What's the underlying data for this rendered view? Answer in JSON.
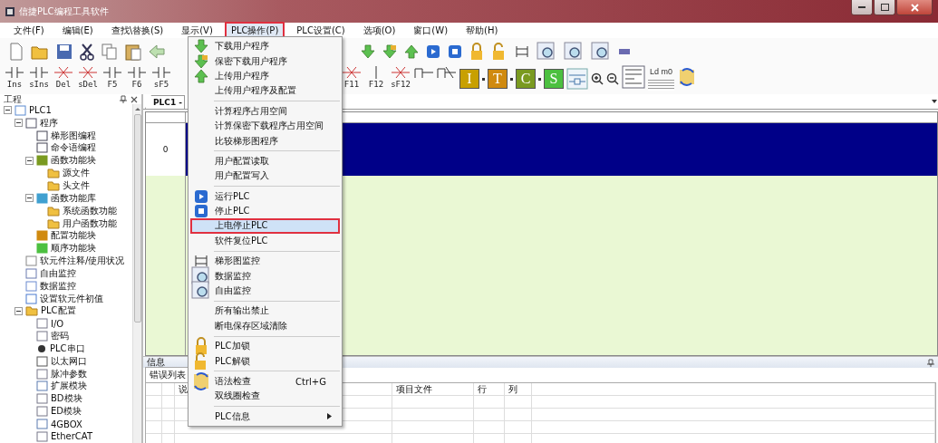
{
  "window": {
    "title": "信捷PLC编程工具软件"
  },
  "menu_bar": [
    {
      "label": "文件(F)",
      "open": false,
      "annotated": false
    },
    {
      "label": "编辑(E)",
      "open": false,
      "annotated": false
    },
    {
      "label": "查找\\替换(S)",
      "open": false,
      "annotated": false
    },
    {
      "label": "显示(V)",
      "open": false,
      "annotated": false
    },
    {
      "label": "PLC操作(P)",
      "open": true,
      "annotated": true
    },
    {
      "label": "PLC设置(C)",
      "open": false,
      "annotated": false
    },
    {
      "label": "选项(O)",
      "open": false,
      "annotated": false
    },
    {
      "label": "窗口(W)",
      "open": false,
      "annotated": false
    },
    {
      "label": "帮助(H)",
      "open": false,
      "annotated": false
    }
  ],
  "toolbar_keys_left": [
    "Ins",
    "sIns",
    "Del",
    "sDel",
    "F5",
    "F6",
    "sF5"
  ],
  "toolbar_keys_right": [
    "F11",
    "F12",
    "sF12"
  ],
  "toolbar_letters": [
    {
      "label": "I",
      "color": "#c8a000"
    },
    {
      "label": "T",
      "color": "#d08a10"
    },
    {
      "label": "C",
      "color": "#7a9a20"
    },
    {
      "label": "S",
      "color": "#4cc040"
    }
  ],
  "toolbar_ld_label": "Ld m0",
  "project_panel": {
    "title": "工程",
    "tree": [
      {
        "label": "PLC1",
        "kind": "project",
        "expanded": true,
        "children": [
          {
            "label": "程序",
            "kind": "program",
            "expanded": true,
            "children": [
              {
                "label": "梯形图编程",
                "kind": "ladder"
              },
              {
                "label": "命令语编程",
                "kind": "command"
              },
              {
                "label": "函数功能块",
                "kind": "block-c",
                "expanded": true,
                "children": [
                  {
                    "label": "源文件",
                    "kind": "folder"
                  },
                  {
                    "label": "头文件",
                    "kind": "folder"
                  }
                ]
              },
              {
                "label": "函数功能库",
                "kind": "block-ex",
                "expanded": true,
                "children": [
                  {
                    "label": "系统函数功能",
                    "kind": "folder"
                  },
                  {
                    "label": "用户函数功能",
                    "kind": "folder"
                  }
                ]
              },
              {
                "label": "配置功能块",
                "kind": "block-t"
              },
              {
                "label": "顺序功能块",
                "kind": "block-s"
              }
            ]
          },
          {
            "label": "软元件注释/使用状况",
            "kind": "list"
          },
          {
            "label": "自由监控",
            "kind": "monitor"
          },
          {
            "label": "数据监控",
            "kind": "data"
          },
          {
            "label": "设置软元件初值",
            "kind": "settings"
          },
          {
            "label": "PLC配置",
            "kind": "folder",
            "expanded": true,
            "children": [
              {
                "label": "I/O",
                "kind": "io"
              },
              {
                "label": "密码",
                "kind": "password"
              },
              {
                "label": "PLC串口",
                "kind": "port"
              },
              {
                "label": "以太网口",
                "kind": "ethernet"
              },
              {
                "label": "脉冲参数",
                "kind": "pulse"
              },
              {
                "label": "扩展模块",
                "kind": "expand"
              },
              {
                "label": "BD模块",
                "kind": "bd"
              },
              {
                "label": "ED模块",
                "kind": "ed"
              },
              {
                "label": "4GBOX",
                "kind": "box"
              },
              {
                "label": "EtherCAT",
                "kind": "ethercat"
              }
            ]
          }
        ]
      }
    ]
  },
  "editor": {
    "tab": "PLC1 -",
    "rung_number": "0"
  },
  "info_panel": {
    "title": "信息",
    "tabs": [
      {
        "label": "错误列表",
        "selected": true
      }
    ],
    "columns": [
      "说",
      "项目文件",
      "行",
      "列"
    ]
  },
  "dropdown": {
    "groups": [
      [
        {
          "label": "下载用户程序",
          "selected": false,
          "annotated": false
        },
        {
          "label": "保密下载用户程序",
          "selected": false,
          "annotated": false
        },
        {
          "label": "上传用户程序",
          "selected": false,
          "annotated": false
        },
        {
          "label": "上传用户程序及配置",
          "selected": false,
          "annotated": false
        }
      ],
      [
        {
          "label": "计算程序占用空间",
          "selected": false,
          "annotated": false
        },
        {
          "label": "计算保密下载程序占用空间",
          "selected": false,
          "annotated": false
        },
        {
          "label": "比较梯形图程序",
          "selected": false,
          "annotated": false
        }
      ],
      [
        {
          "label": "用户配置读取",
          "selected": false,
          "annotated": false
        },
        {
          "label": "用户配置写入",
          "selected": false,
          "annotated": false
        }
      ],
      [
        {
          "label": "运行PLC",
          "selected": false,
          "annotated": false
        },
        {
          "label": "停止PLC",
          "selected": false,
          "annotated": false
        },
        {
          "label": "上电停止PLC",
          "selected": true,
          "annotated": true
        },
        {
          "label": "软件复位PLC",
          "selected": false,
          "annotated": false
        }
      ],
      [
        {
          "label": "梯形图监控",
          "selected": false,
          "annotated": false
        },
        {
          "label": "数据监控",
          "selected": false,
          "annotated": false
        },
        {
          "label": "自由监控",
          "selected": false,
          "annotated": false
        }
      ],
      [
        {
          "label": "所有输出禁止",
          "selected": false,
          "annotated": false
        },
        {
          "label": "断电保存区域清除",
          "selected": false,
          "annotated": false
        }
      ],
      [
        {
          "label": "PLC加锁",
          "selected": false,
          "annotated": false
        },
        {
          "label": "PLC解锁",
          "selected": false,
          "annotated": false
        }
      ],
      [
        {
          "label": "语法检查",
          "shortcut": "Ctrl+G",
          "selected": false,
          "annotated": false
        },
        {
          "label": "双线圈检查",
          "selected": false,
          "annotated": false
        }
      ],
      [
        {
          "label": "PLC信息",
          "submenu": true,
          "selected": false,
          "annotated": false
        }
      ]
    ]
  }
}
